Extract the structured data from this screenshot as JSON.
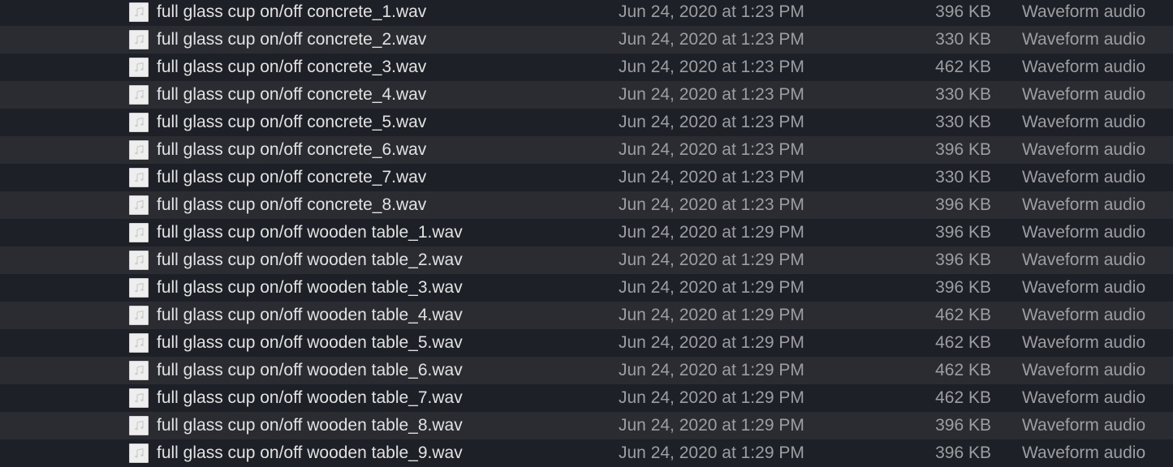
{
  "colors": {
    "row_dark": "#1e2027",
    "row_light": "#2a2c32",
    "name_text": "#e2e2e2",
    "meta_text": "#9d9ea2"
  },
  "file_icon": "audio-file-icon",
  "files": [
    {
      "name": "full glass cup on/off concrete_1.wav",
      "date": "Jun 24, 2020 at 1:23 PM",
      "size": "396 KB",
      "kind": "Waveform audio"
    },
    {
      "name": "full glass cup on/off concrete_2.wav",
      "date": "Jun 24, 2020 at 1:23 PM",
      "size": "330 KB",
      "kind": "Waveform audio"
    },
    {
      "name": "full glass cup on/off concrete_3.wav",
      "date": "Jun 24, 2020 at 1:23 PM",
      "size": "462 KB",
      "kind": "Waveform audio"
    },
    {
      "name": "full glass cup on/off concrete_4.wav",
      "date": "Jun 24, 2020 at 1:23 PM",
      "size": "330 KB",
      "kind": "Waveform audio"
    },
    {
      "name": "full glass cup on/off concrete_5.wav",
      "date": "Jun 24, 2020 at 1:23 PM",
      "size": "330 KB",
      "kind": "Waveform audio"
    },
    {
      "name": "full glass cup on/off concrete_6.wav",
      "date": "Jun 24, 2020 at 1:23 PM",
      "size": "396 KB",
      "kind": "Waveform audio"
    },
    {
      "name": "full glass cup on/off concrete_7.wav",
      "date": "Jun 24, 2020 at 1:23 PM",
      "size": "330 KB",
      "kind": "Waveform audio"
    },
    {
      "name": "full glass cup on/off concrete_8.wav",
      "date": "Jun 24, 2020 at 1:23 PM",
      "size": "396 KB",
      "kind": "Waveform audio"
    },
    {
      "name": "full glass cup on/off wooden table_1.wav",
      "date": "Jun 24, 2020 at 1:29 PM",
      "size": "396 KB",
      "kind": "Waveform audio"
    },
    {
      "name": "full glass cup on/off wooden table_2.wav",
      "date": "Jun 24, 2020 at 1:29 PM",
      "size": "396 KB",
      "kind": "Waveform audio"
    },
    {
      "name": "full glass cup on/off wooden table_3.wav",
      "date": "Jun 24, 2020 at 1:29 PM",
      "size": "396 KB",
      "kind": "Waveform audio"
    },
    {
      "name": "full glass cup on/off wooden table_4.wav",
      "date": "Jun 24, 2020 at 1:29 PM",
      "size": "462 KB",
      "kind": "Waveform audio"
    },
    {
      "name": "full glass cup on/off wooden table_5.wav",
      "date": "Jun 24, 2020 at 1:29 PM",
      "size": "462 KB",
      "kind": "Waveform audio"
    },
    {
      "name": "full glass cup on/off wooden table_6.wav",
      "date": "Jun 24, 2020 at 1:29 PM",
      "size": "462 KB",
      "kind": "Waveform audio"
    },
    {
      "name": "full glass cup on/off wooden table_7.wav",
      "date": "Jun 24, 2020 at 1:29 PM",
      "size": "462 KB",
      "kind": "Waveform audio"
    },
    {
      "name": "full glass cup on/off wooden table_8.wav",
      "date": "Jun 24, 2020 at 1:29 PM",
      "size": "396 KB",
      "kind": "Waveform audio"
    },
    {
      "name": "full glass cup on/off wooden table_9.wav",
      "date": "Jun 24, 2020 at 1:29 PM",
      "size": "396 KB",
      "kind": "Waveform audio"
    }
  ]
}
